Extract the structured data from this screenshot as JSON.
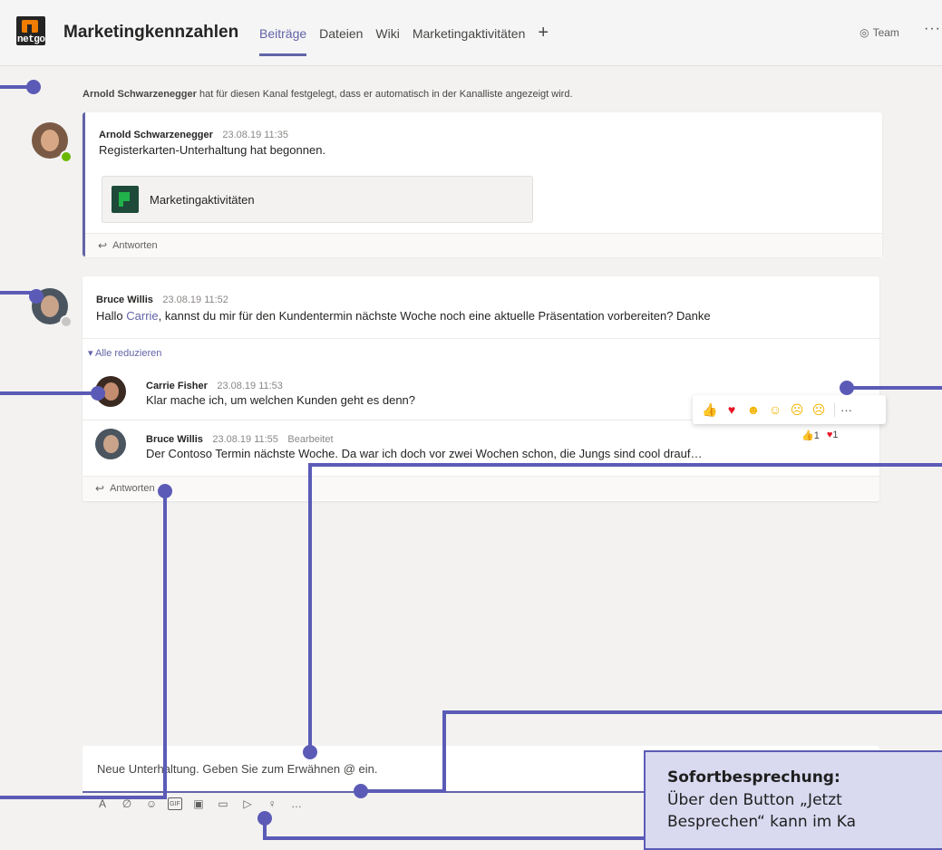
{
  "header": {
    "logo_text": "netgo",
    "team_title": "Marketingkennzahlen",
    "tabs": [
      {
        "label": "Beiträge",
        "active": true
      },
      {
        "label": "Dateien"
      },
      {
        "label": "Wiki"
      },
      {
        "label": "Marketingaktivitäten"
      }
    ],
    "add_tab_icon": "plus-icon",
    "team_button_label": "Team",
    "more_icon": "more-dots-icon"
  },
  "system_message": {
    "actor": "Arnold Schwarzenegger",
    "text": "hat für diesen Kanal festgelegt, dass er automatisch in der Kanalliste angezeigt wird."
  },
  "posts": [
    {
      "author": "Arnold Schwarzenegger",
      "time": "23.08.19 11:35",
      "text": "Registerkarten-Unterhaltung hat begonnen.",
      "attachment": "Marketingaktivitäten",
      "reply_label": "Antworten",
      "status": "online"
    },
    {
      "author": "Bruce Willis",
      "time": "23.08.19 11:52",
      "text_before": "Hallo",
      "mention": "Carrie",
      "text_after": ", kannst du mir für den Kundentermin nächste Woche noch eine aktuelle Präsentation vorbereiten? Danke",
      "collapse_label": "Alle reduzieren",
      "status": "away",
      "replies": [
        {
          "author": "Carrie Fisher",
          "time": "23.08.19 11:53",
          "text": "Klar mache ich, um welchen Kunden geht es denn?"
        },
        {
          "author": "Bruce Willis",
          "time": "23.08.19 11:55",
          "edited": "Bearbeitet",
          "text": "Der Contoso Termin nächste Woche. Da war ich doch vor zwei Wochen schon, die Jungs sind cool drauf…"
        }
      ],
      "reply_label": "Antworten"
    }
  ],
  "reactions": {
    "toolbar": [
      "thumbs-up-icon",
      "heart-icon",
      "laugh-icon",
      "surprised-icon",
      "sad-icon",
      "angry-icon"
    ],
    "counts": {
      "like": "1",
      "heart": "1"
    }
  },
  "compose": {
    "placeholder": "Neue Unterhaltung. Geben Sie zum Erwähnen @ ein.",
    "tools": [
      "format-icon",
      "attach-icon",
      "emoji-icon",
      "gif-icon",
      "sticker-icon",
      "meet-now-icon",
      "send-icon",
      "praise-icon",
      "more-icon"
    ]
  },
  "callout": {
    "title": "Sofortbesprechung:",
    "line1": "Über den Button „Jetzt",
    "line2": "Besprechen“ kann im Ka"
  },
  "colors": {
    "accent": "#6264a7",
    "callout_line": "#5b5bb7",
    "callout_bg": "#d9d9f0"
  }
}
